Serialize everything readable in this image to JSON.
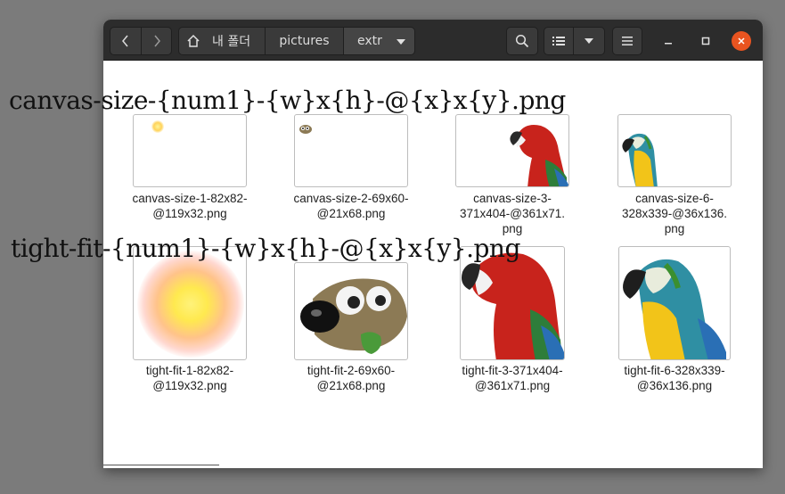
{
  "window": {
    "breadcrumbs": [
      "내 폴더",
      "pictures",
      "extr"
    ]
  },
  "overlay": {
    "line1": "canvas-size-{num1}-{w}x{h}-@{x}x{y}.png",
    "line2": "tight-fit-{num1}-{w}x{h}-@{x}x{y}.png"
  },
  "files": [
    {
      "line1": "canvas-size-1-82x82-",
      "line2": "@119x32.png",
      "line3": ""
    },
    {
      "line1": "canvas-size-2-69x60-",
      "line2": "@21x68.png",
      "line3": ""
    },
    {
      "line1": "canvas-size-3-",
      "line2": "371x404-@361x71.",
      "line3": "png"
    },
    {
      "line1": "canvas-size-6-",
      "line2": "328x339-@36x136.",
      "line3": "png"
    },
    {
      "line1": "tight-fit-1-82x82-",
      "line2": "@119x32.png",
      "line3": ""
    },
    {
      "line1": "tight-fit-2-69x60-",
      "line2": "@21x68.png",
      "line3": ""
    },
    {
      "line1": "tight-fit-3-371x404-",
      "line2": "@361x71.png",
      "line3": ""
    },
    {
      "line1": "tight-fit-6-328x339-",
      "line2": "@36x136.png",
      "line3": ""
    }
  ],
  "colors": {
    "close_button": "#e95420",
    "headerbar": "#2c2c2c",
    "desktop": "#7b7b7b"
  },
  "icons": [
    "back-icon",
    "forward-icon",
    "home-icon",
    "search-icon",
    "list-view-icon",
    "dropdown-icon",
    "hamburger-menu-icon",
    "minimize-icon",
    "maximize-icon",
    "close-icon"
  ]
}
